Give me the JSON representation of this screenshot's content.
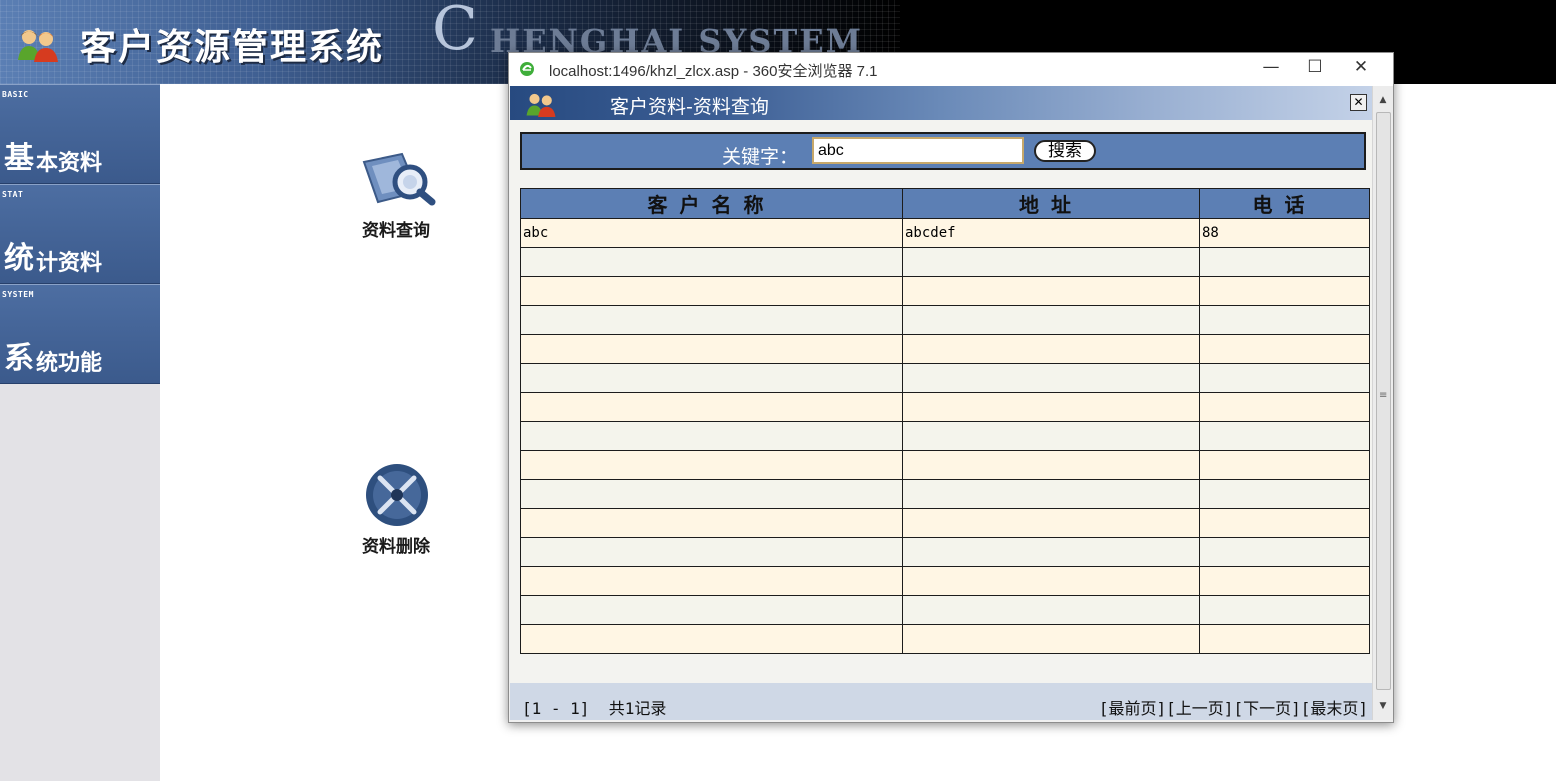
{
  "header": {
    "app_title": "客户资源管理系统",
    "brand_c": "C",
    "brand_rest": "HENGHAI SYSTEM"
  },
  "sidebar": {
    "items": [
      {
        "en": "BASIC",
        "big": "基",
        "small": "本资料"
      },
      {
        "en": "STAT",
        "big": "统",
        "small": "计资料"
      },
      {
        "en": "SYSTEM",
        "big": "系",
        "small": "统功能"
      }
    ]
  },
  "main": {
    "query_label": "资料查询",
    "delete_label": "资料删除"
  },
  "browser_window": {
    "title": "localhost:1496/khzl_zlcx.asp - 360安全浏览器 7.1",
    "minimize": "—",
    "maximize": "☐",
    "close": "✕"
  },
  "panel": {
    "title": "客户资料-资料查询",
    "close": "✕"
  },
  "search": {
    "label": "关键字：",
    "value": "abc",
    "button": "搜索"
  },
  "table": {
    "headers": [
      "客户名称",
      "地址",
      "电话"
    ],
    "rows": [
      [
        "abc",
        "abcdef",
        "88"
      ],
      [
        "",
        "",
        ""
      ],
      [
        "",
        "",
        ""
      ],
      [
        "",
        "",
        ""
      ],
      [
        "",
        "",
        ""
      ],
      [
        "",
        "",
        ""
      ],
      [
        "",
        "",
        ""
      ],
      [
        "",
        "",
        ""
      ],
      [
        "",
        "",
        ""
      ],
      [
        "",
        "",
        ""
      ],
      [
        "",
        "",
        ""
      ],
      [
        "",
        "",
        ""
      ],
      [
        "",
        "",
        ""
      ],
      [
        "",
        "",
        ""
      ],
      [
        "",
        "",
        ""
      ]
    ]
  },
  "pager": {
    "range": "[1 - 1]",
    "count": "共1记录",
    "first": "[最前页]",
    "prev": "[上一页]",
    "next": "[下一页]",
    "last": "[最末页]"
  },
  "colors": {
    "header_blue": "#5c7fb4",
    "row_odd": "#fff6e4",
    "row_even": "#f4f4ec",
    "sidebar_blue": "#4d6ea2"
  }
}
